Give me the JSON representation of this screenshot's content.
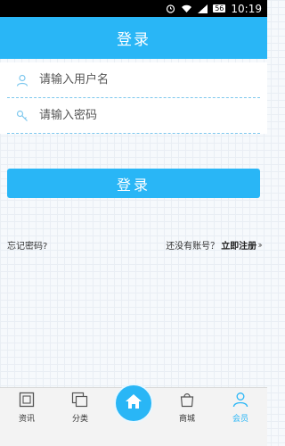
{
  "status_bar": {
    "battery": "56",
    "time": "10:19"
  },
  "header": {
    "title": "登录"
  },
  "form": {
    "username_placeholder": "请输入用户名",
    "password_placeholder": "请输入密码"
  },
  "login_button": "登录",
  "links": {
    "forgot_password": "忘记密码?",
    "no_account": "还没有账号？",
    "register": "立即注册"
  },
  "bottom_nav": {
    "items": [
      {
        "label": "资讯",
        "icon": "news-icon"
      },
      {
        "label": "分类",
        "icon": "category-icon"
      },
      {
        "label": "",
        "icon": "home-icon"
      },
      {
        "label": "商城",
        "icon": "shop-icon"
      },
      {
        "label": "会员",
        "icon": "member-icon"
      }
    ],
    "active": "会员"
  },
  "colors": {
    "accent": "#29b6f6",
    "status_bar": "#000000"
  }
}
